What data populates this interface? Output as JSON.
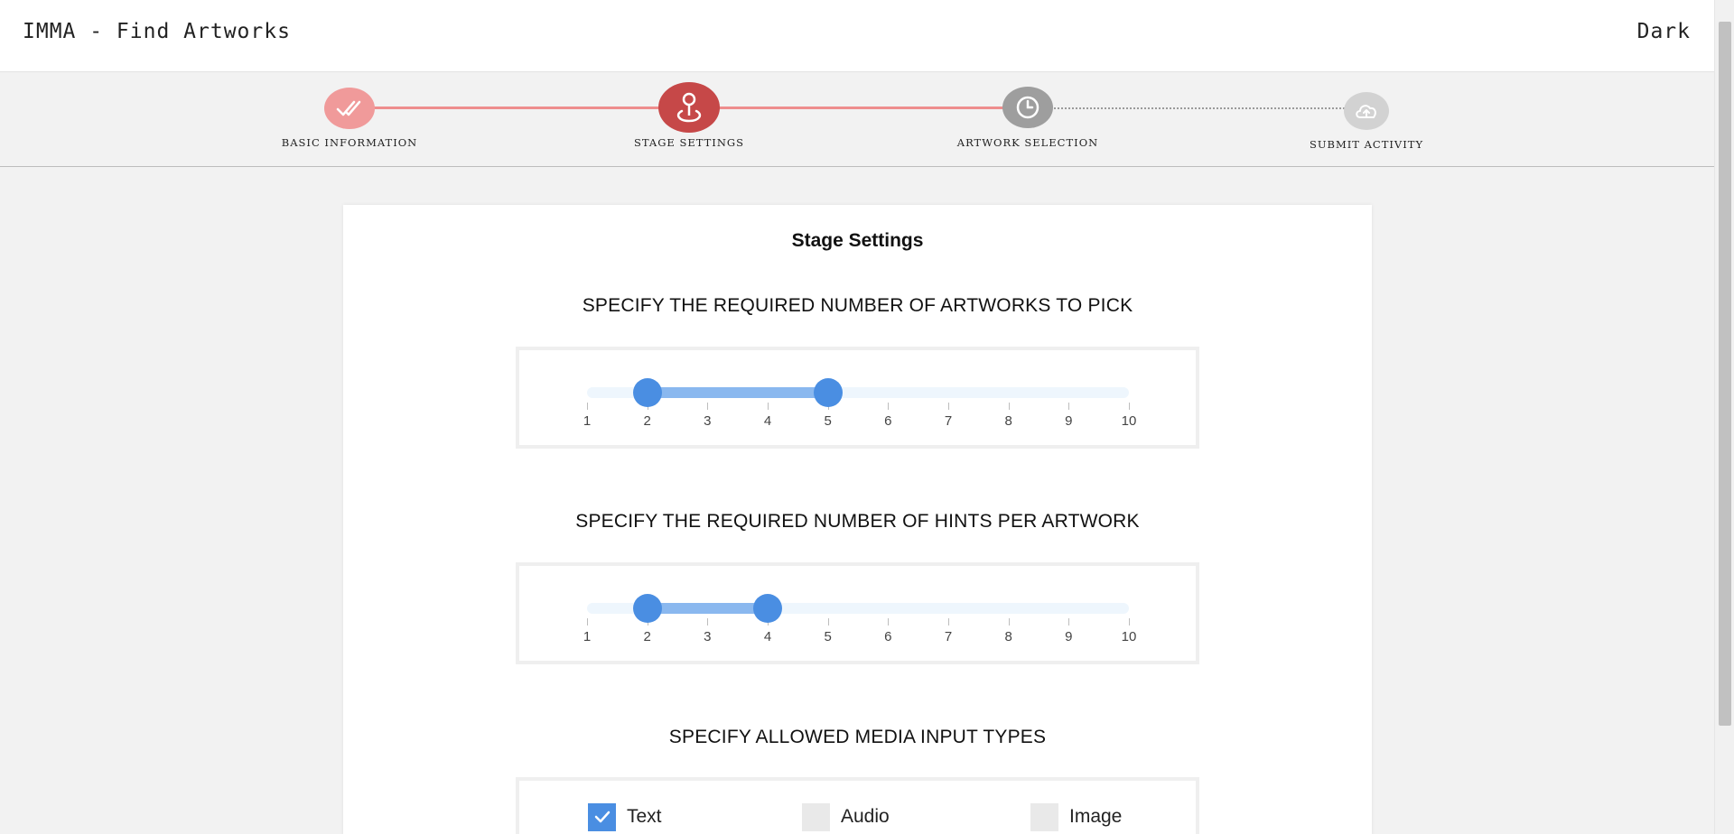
{
  "app": {
    "title": "IMMA - Find Artworks",
    "theme_toggle": "Dark"
  },
  "stepper": {
    "steps": [
      {
        "label": "BASIC INFORMATION",
        "status": "completed",
        "icon": "double-check-icon",
        "color": "#f09a9a"
      },
      {
        "label": "STAGE SETTINGS",
        "status": "active",
        "icon": "location-pin-icon",
        "color": "#c64848"
      },
      {
        "label": "ARTWORK SELECTION",
        "status": "pending",
        "icon": "clock-icon",
        "color": "#9e9e9e"
      },
      {
        "label": "SUBMIT ACTIVITY",
        "status": "pending",
        "icon": "cloud-upload-icon",
        "color": "#d2d2d2"
      }
    ]
  },
  "card": {
    "title": "Stage Settings",
    "artworks": {
      "heading": "SPECIFY THE REQUIRED NUMBER OF ARTWORKS TO PICK",
      "min": 1,
      "max": 10,
      "range_low": 2,
      "range_high": 5,
      "ticks": [
        "1",
        "2",
        "3",
        "4",
        "5",
        "6",
        "7",
        "8",
        "9",
        "10"
      ]
    },
    "hints": {
      "heading": "SPECIFY THE REQUIRED NUMBER OF HINTS PER ARTWORK",
      "min": 1,
      "max": 10,
      "range_low": 2,
      "range_high": 4,
      "ticks": [
        "1",
        "2",
        "3",
        "4",
        "5",
        "6",
        "7",
        "8",
        "9",
        "10"
      ]
    },
    "media": {
      "heading": "SPECIFY ALLOWED MEDIA INPUT TYPES",
      "options": [
        {
          "label": "Text",
          "checked": true
        },
        {
          "label": "Audio",
          "checked": false
        },
        {
          "label": "Image",
          "checked": false
        }
      ]
    }
  },
  "colors": {
    "accent_blue": "#4a8ee2",
    "range_fill": "#8ab8ef",
    "active_step": "#c64848"
  }
}
